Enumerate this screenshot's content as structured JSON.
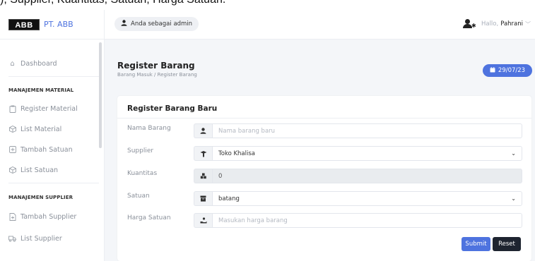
{
  "caption": "), Supplier, Kuantitas, Satuan, Harga Satuan.",
  "brand": {
    "logo_text": "ABB",
    "name": "PT. ABB"
  },
  "topbar": {
    "admin_badge": "Anda sebagai admin",
    "greeting": "Hallo,",
    "username": "Pahrani"
  },
  "sidebar": {
    "dashboard": "Dashboard",
    "section_material": "MANAJEMEN MATERIAL",
    "material_items": [
      "Register Material",
      "List Material",
      "Tambah Satuan",
      "List Satuan"
    ],
    "section_supplier": "MANAJEMEN SUPPLIER",
    "supplier_items": [
      "Tambah Supplier",
      "List Supplier"
    ]
  },
  "page": {
    "title": "Register Barang",
    "breadcrumb": "Barang Masuk / Register Barang",
    "date": "29/07/23"
  },
  "form": {
    "title": "Register Barang Baru",
    "nama_label": "Nama Barang",
    "nama_placeholder": "Nama barang baru",
    "supplier_label": "Supplier",
    "supplier_value": "Toko Khalisa",
    "kuantitas_label": "Kuantitas",
    "kuantitas_value": "0",
    "satuan_label": "Satuan",
    "satuan_value": "batang",
    "harga_label": "Harga Satuan",
    "harga_placeholder": "Masukan harga barang",
    "submit_label": "Submit",
    "reset_label": "Reset"
  },
  "icons": {
    "nama": "user-icon",
    "supplier": "truck-icon",
    "kuantitas": "cubes-icon",
    "satuan": "box-icon",
    "harga": "money-hand-icon"
  },
  "colors": {
    "primary": "#4e73df",
    "dark_button": "#1e2430"
  }
}
